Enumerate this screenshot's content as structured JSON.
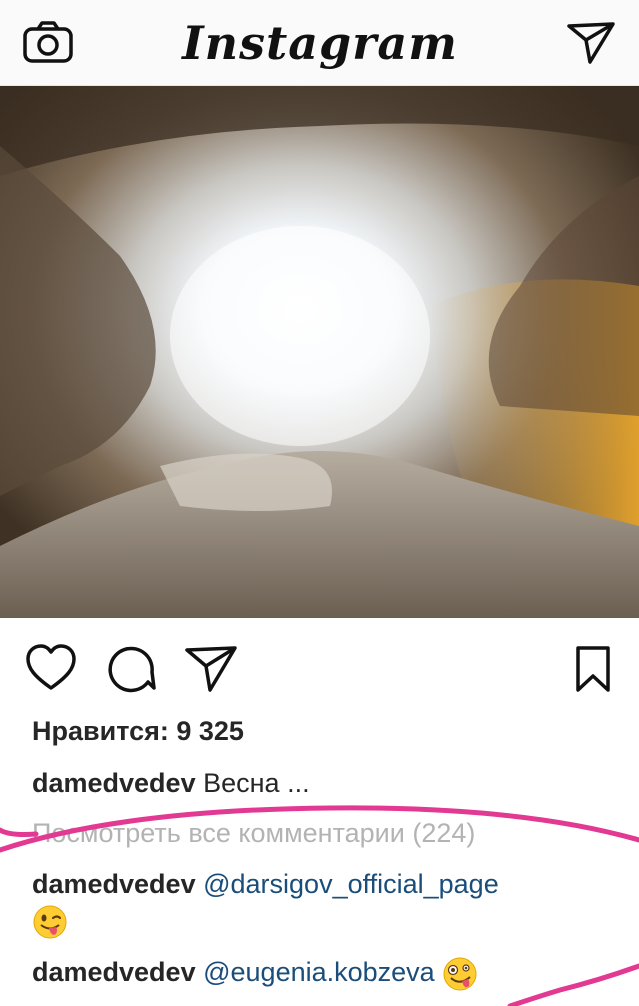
{
  "header": {
    "logo": "Instagram",
    "camera_icon": "camera-icon",
    "direct_icon": "paper-plane-icon"
  },
  "post": {
    "actions": {
      "like_icon": "heart-icon",
      "comment_icon": "comment-bubble-icon",
      "share_icon": "paper-plane-icon",
      "save_icon": "bookmark-icon"
    },
    "likes_text": "Нравится: 9 325",
    "caption": {
      "username": "damedvedev",
      "text": "Весна ..."
    },
    "view_all_comments": "Посмотреть все комментарии (224)",
    "comments": [
      {
        "username": "damedvedev",
        "mention": "@darsigov_official_page",
        "emoji": "winking-face-tongue-emoji"
      },
      {
        "username": "damedvedev",
        "mention": "@eugenia.kobzeva",
        "emoji": "zany-face-emoji"
      }
    ]
  },
  "colors": {
    "mention": "#1a4d7a",
    "annotation_marker": "#e23a93",
    "muted": "#b3b3b3"
  }
}
